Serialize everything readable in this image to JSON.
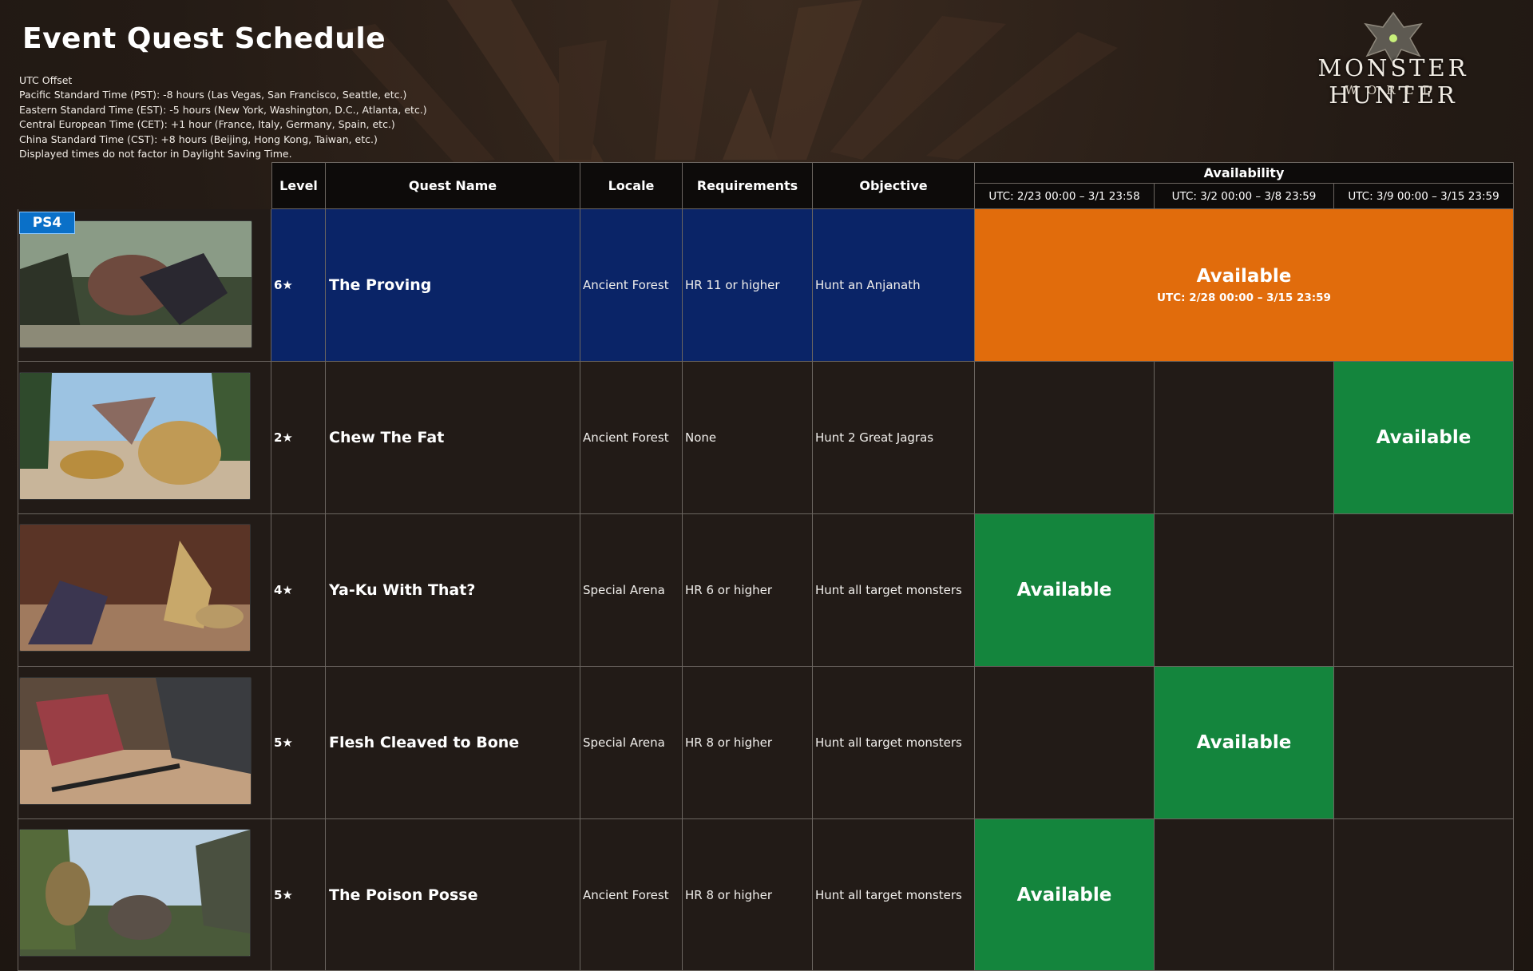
{
  "title": "Event Quest Schedule",
  "utc_notes": [
    "UTC Offset",
    "Pacific Standard Time (PST): -8 hours (Las Vegas, San Francisco, Seattle, etc.)",
    "Eastern Standard Time (EST): -5 hours (New York, Washington, D.C., Atlanta, etc.)",
    "Central European Time (CET): +1 hour (France, Italy, Germany, Spain, etc.)",
    "China Standard Time (CST): +8 hours (Beijing, Hong Kong, Taiwan, etc.)",
    "Displayed times do not factor in Daylight Saving Time."
  ],
  "logo": {
    "line1": "MONSTER HUNTER",
    "line2": "WORLD"
  },
  "platform_badge": "PS4",
  "headers": {
    "level": "Level",
    "quest_name": "Quest Name",
    "locale": "Locale",
    "requirements": "Requirements",
    "objective": "Objective",
    "availability": "Availability",
    "periods": [
      "UTC: 2/23 00:00 – 3/1 23:58",
      "UTC: 3/2 00:00 – 3/8 23:59",
      "UTC: 3/9 00:00 – 3/15 23:59"
    ]
  },
  "rows": [
    {
      "level": "6★",
      "name": "The Proving",
      "locale": "Ancient Forest",
      "requirements": "HR 11 or higher",
      "objective": "Hunt an Anjanath",
      "availability_label": "Available",
      "availability_note": "UTC: 2/28 00:00 – 3/15 23:59"
    },
    {
      "level": "2★",
      "name": "Chew The Fat",
      "locale": "Ancient Forest",
      "requirements": "None",
      "objective": "Hunt 2 Great Jagras",
      "availability_label": "Available"
    },
    {
      "level": "4★",
      "name": "Ya-Ku With That?",
      "locale": "Special Arena",
      "requirements": "HR 6 or higher",
      "objective": "Hunt all target monsters",
      "availability_label": "Available"
    },
    {
      "level": "5★",
      "name": "Flesh Cleaved to Bone",
      "locale": "Special Arena",
      "requirements": "HR 8 or higher",
      "objective": "Hunt all target monsters",
      "availability_label": "Available"
    },
    {
      "level": "5★",
      "name": "The Poison Posse",
      "locale": "Ancient Forest",
      "requirements": "HR 8 or higher",
      "objective": "Hunt all target monsters",
      "availability_label": "Available"
    }
  ],
  "colors": {
    "highlight_row": "#0a2467",
    "available_green": "#14853d",
    "available_orange": "#e16c0c"
  }
}
